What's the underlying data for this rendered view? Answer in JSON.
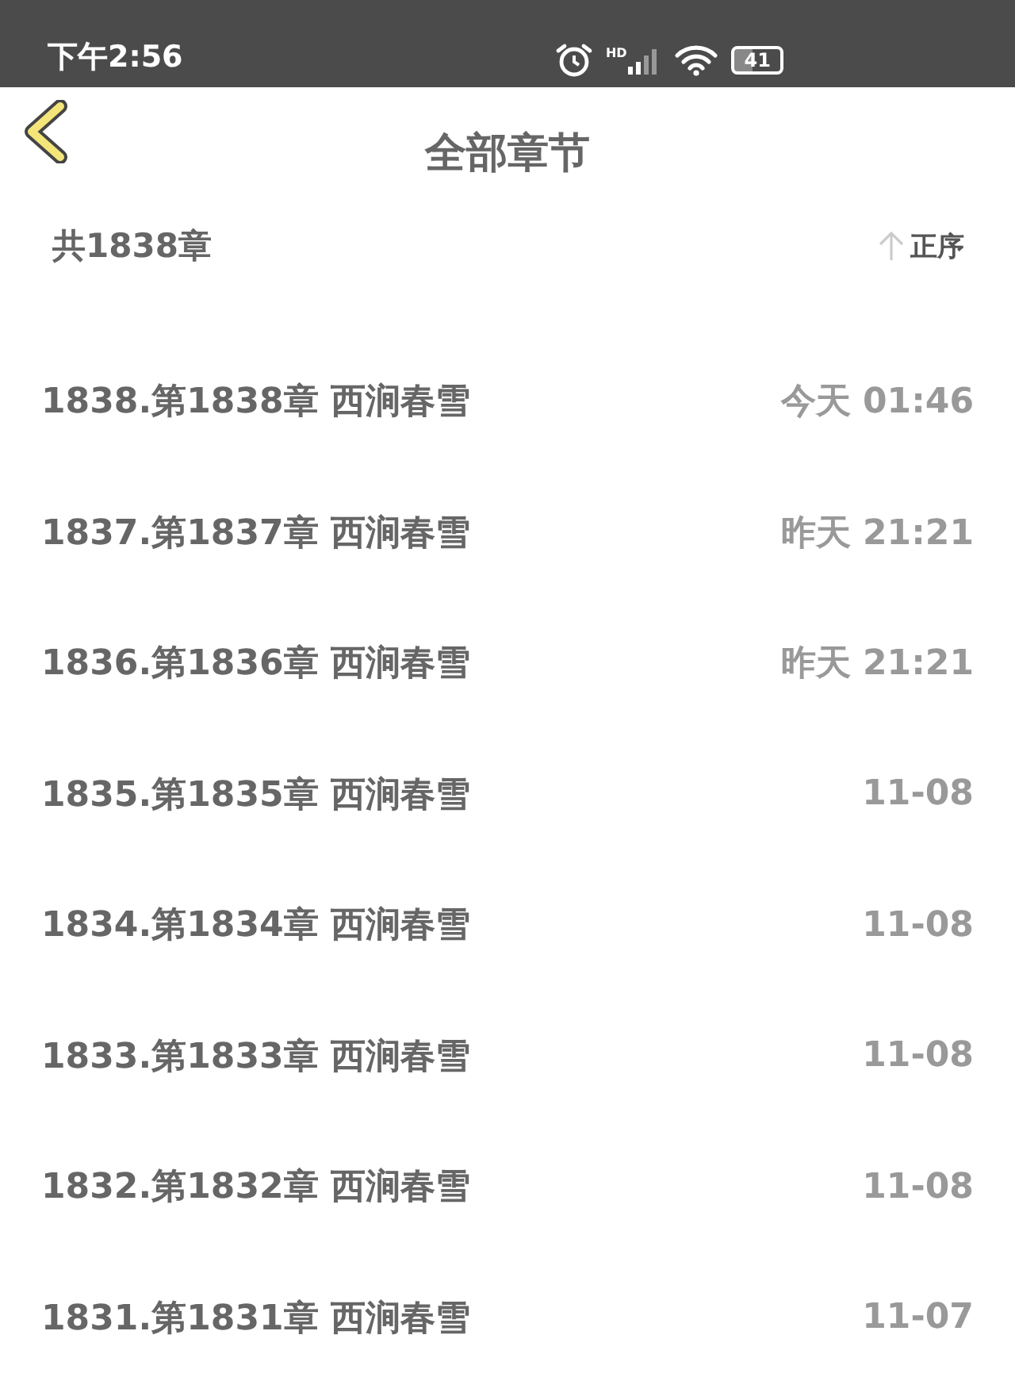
{
  "status_bar": {
    "time": "下午2:56",
    "network_label": "HD",
    "battery": "41"
  },
  "header": {
    "title": "全部章节"
  },
  "summary": {
    "count": "共1838章",
    "sort_label": "正序"
  },
  "chapters": [
    {
      "title": "1838.第1838章 西涧春雪",
      "date": "今天 01:46"
    },
    {
      "title": "1837.第1837章 西涧春雪",
      "date": "昨天 21:21"
    },
    {
      "title": "1836.第1836章 西涧春雪",
      "date": "昨天 21:21"
    },
    {
      "title": "1835.第1835章 西涧春雪",
      "date": "11-08"
    },
    {
      "title": "1834.第1834章 西涧春雪",
      "date": "11-08"
    },
    {
      "title": "1833.第1833章 西涧春雪",
      "date": "11-08"
    },
    {
      "title": "1832.第1832章 西涧春雪",
      "date": "11-08"
    },
    {
      "title": "1831.第1831章 西涧春雪",
      "date": "11-07"
    }
  ]
}
